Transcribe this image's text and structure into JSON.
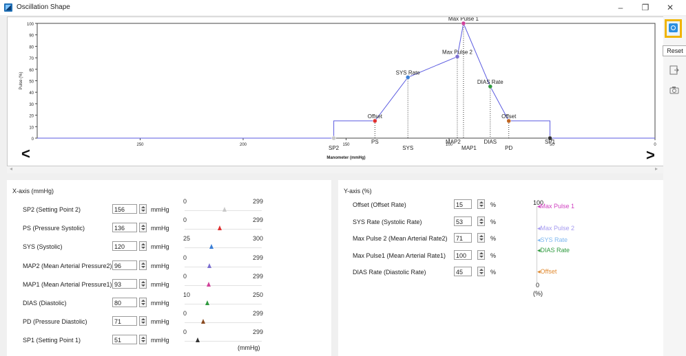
{
  "window": {
    "title": "Oscillation Shape",
    "minimize": "–",
    "maximize": "❐",
    "close": "✕"
  },
  "toolbar": {
    "reset_tooltip": "Reset",
    "tools": [
      "refresh-icon",
      "export-icon",
      "camera-icon"
    ]
  },
  "colors": {
    "line": "#5a5ae0",
    "sp": "#c8c8c8",
    "ps": "#e03030",
    "sys": "#3b7fd6",
    "map2": "#7b6fd0",
    "map1": "#d0409a",
    "dias": "#2e9a3e",
    "pd": "#c06420",
    "sp1": "#333333",
    "accent": "#f0b400"
  },
  "chart_data": {
    "type": "line",
    "title": "",
    "xlabel": "Manometer (mmHg)",
    "ylabel": "Pulse (%)",
    "xlim": [
      300,
      0
    ],
    "ylim": [
      0,
      100
    ],
    "x_ticks": [
      "250",
      "200",
      "150",
      "100",
      "50",
      "0"
    ],
    "y_ticks": [
      "0",
      "10",
      "20",
      "30",
      "40",
      "50",
      "60",
      "70",
      "80",
      "90",
      "100"
    ],
    "series": [
      {
        "x": [
          300,
          156,
          156,
          136,
          120,
          96,
          93,
          80,
          71,
          51,
          51,
          0
        ],
        "y": [
          0,
          0,
          15,
          15,
          53,
          71,
          100,
          45,
          15,
          15,
          0,
          0
        ]
      }
    ],
    "points": [
      {
        "x": 156,
        "y": 0,
        "label": "SP2",
        "ctrl": "sp"
      },
      {
        "x": 136,
        "y": 15,
        "label": "Offset",
        "ctrl": "ps"
      },
      {
        "x": 120,
        "y": 53,
        "label": "SYS Rate",
        "ctrl": "sys"
      },
      {
        "x": 96,
        "y": 71,
        "label": "Max Pulse 2",
        "ctrl": "map2"
      },
      {
        "x": 93,
        "y": 100,
        "label": "Max Pulse 1",
        "ctrl": "map1"
      },
      {
        "x": 80,
        "y": 45,
        "label": "DIAS Rate",
        "ctrl": "dias"
      },
      {
        "x": 71,
        "y": 15,
        "label": "Offset",
        "ctrl": "pd"
      },
      {
        "x": 51,
        "y": 0,
        "label": "SP1",
        "ctrl": "sp1"
      }
    ],
    "markers": [
      {
        "x": 156,
        "label": "SP2",
        "line": false
      },
      {
        "x": 136,
        "label": "PS",
        "line": true
      },
      {
        "x": 120,
        "label": "SYS",
        "line": true
      },
      {
        "x": 96,
        "label": "MAP2",
        "line": true
      },
      {
        "x": 93,
        "label": "MAP1",
        "line": true
      },
      {
        "x": 80,
        "label": "DIAS",
        "line": true
      },
      {
        "x": 71,
        "label": "PD",
        "line": true
      },
      {
        "x": 51,
        "label": "SP1",
        "line": false
      }
    ]
  },
  "x_axis": {
    "title": "X-axis (mmHg)",
    "unit": "mmHg",
    "footer_unit": "(mmHg)",
    "rows": [
      {
        "label": "SP2 (Setting Point 2)",
        "value": "156",
        "min": "0",
        "max": "299",
        "min_n": 0,
        "max_n": 299,
        "val_n": 156,
        "color": "#c8c8c8"
      },
      {
        "label": "PS (Pressure Systolic)",
        "value": "136",
        "min": "0",
        "max": "299",
        "min_n": 0,
        "max_n": 299,
        "val_n": 136,
        "color": "#e03030"
      },
      {
        "label": "SYS (Systolic)",
        "value": "120",
        "min": "25",
        "max": "300",
        "min_n": 25,
        "max_n": 300,
        "val_n": 120,
        "color": "#3b7fd6"
      },
      {
        "label": "MAP2 (Mean Arterial Pressure2)",
        "value": "96",
        "min": "0",
        "max": "299",
        "min_n": 0,
        "max_n": 299,
        "val_n": 96,
        "color": "#7b6fd0"
      },
      {
        "label": "MAP1 (Mean Arterial Pressure1)",
        "value": "93",
        "min": "0",
        "max": "299",
        "min_n": 0,
        "max_n": 299,
        "val_n": 93,
        "color": "#d0409a"
      },
      {
        "label": "DIAS (Diastolic)",
        "value": "80",
        "min": "10",
        "max": "250",
        "min_n": 10,
        "max_n": 250,
        "val_n": 80,
        "color": "#2e9a3e"
      },
      {
        "label": "PD (Pressure Diastolic)",
        "value": "71",
        "min": "0",
        "max": "299",
        "min_n": 0,
        "max_n": 299,
        "val_n": 71,
        "color": "#8a4a20"
      },
      {
        "label": "SP1 (Setting Point 1)",
        "value": "51",
        "min": "0",
        "max": "299",
        "min_n": 0,
        "max_n": 299,
        "val_n": 51,
        "color": "#333333"
      }
    ]
  },
  "y_axis": {
    "title": "Y-axis (%)",
    "unit": "%",
    "rows": [
      {
        "label": "Offset (Offset Rate)",
        "value": "15"
      },
      {
        "label": "SYS Rate (Systolic Rate)",
        "value": "53"
      },
      {
        "label": "Max Pulse 2 (Mean Arterial Rate2)",
        "value": "71"
      },
      {
        "label": "Max Pulse1 (Mean Arterial Rate1)",
        "value": "100"
      },
      {
        "label": "DIAS Rate (Diastolic Rate)",
        "value": "45"
      }
    ],
    "scale": {
      "top": "100",
      "bottom": "0",
      "unit": "(%)"
    },
    "markers": [
      {
        "label": "Max Pulse 1",
        "pct": 100,
        "color": "#d040c0"
      },
      {
        "label": "Max Pulse 2",
        "pct": 71,
        "color": "#a59af0"
      },
      {
        "label": "SYS Rate",
        "pct": 53,
        "color": "#7fb8f0"
      },
      {
        "label": "DIAS Rate",
        "pct": 45,
        "color": "#2e9a3e"
      },
      {
        "label": "Offset",
        "pct": 15,
        "color": "#e08a30"
      }
    ]
  }
}
